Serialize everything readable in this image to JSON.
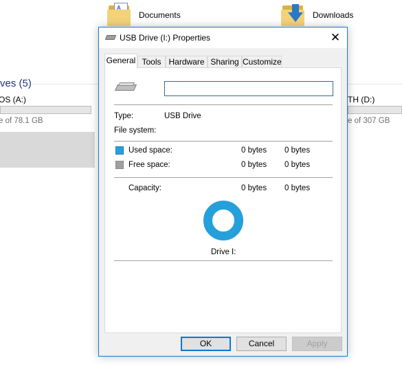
{
  "background": {
    "folders": [
      {
        "label": "Documents",
        "icon": "documents-folder-icon"
      },
      {
        "label": "Downloads",
        "icon": "downloads-folder-icon"
      }
    ],
    "section_heading": "ves (5)",
    "drives": [
      {
        "name": "OS (A:)",
        "free_text": "e of 78.1 GB"
      },
      {
        "name": "TH (D:)",
        "free_text": "e of 307 GB"
      }
    ]
  },
  "dialog": {
    "title": "USB Drive (I:) Properties",
    "close_glyph": "✕",
    "tabs": [
      "General",
      "Tools",
      "Hardware",
      "Sharing",
      "Customize"
    ],
    "active_tab": "General",
    "name_value": "",
    "type_label": "Type:",
    "type_value": "USB Drive",
    "fs_label": "File system:",
    "fs_value": "",
    "used_label": "Used space:",
    "used_bytes": "0 bytes",
    "used_size": "0 bytes",
    "free_label": "Free space:",
    "free_bytes": "0 bytes",
    "free_size": "0 bytes",
    "capacity_label": "Capacity:",
    "capacity_bytes": "0 bytes",
    "capacity_size": "0 bytes",
    "drive_label": "Drive I:",
    "used_color": "#26a0da",
    "free_color": "#a0a0a0",
    "buttons": {
      "ok": "OK",
      "cancel": "Cancel",
      "apply": "Apply"
    }
  }
}
